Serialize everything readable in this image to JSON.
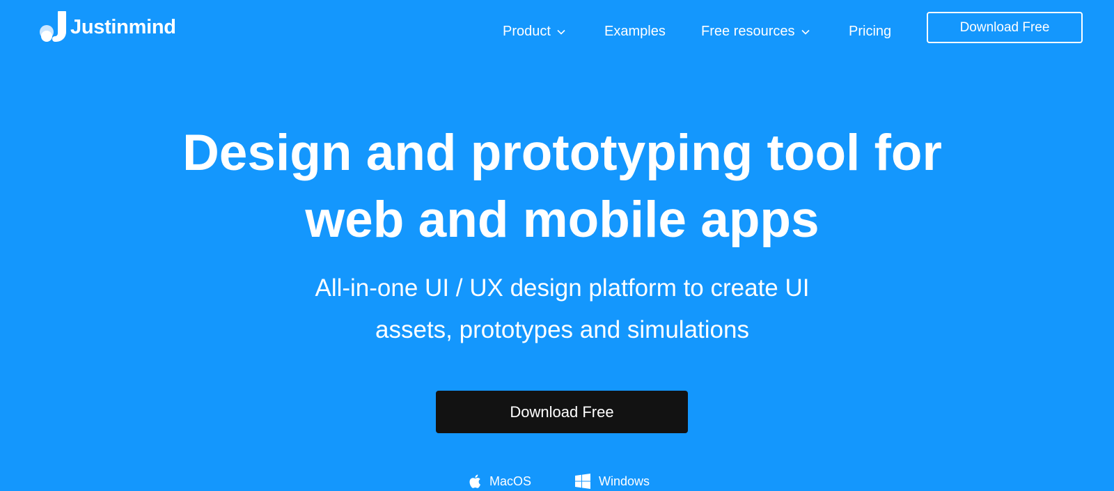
{
  "brand": {
    "name": "Justinmind"
  },
  "nav": {
    "items": [
      {
        "label": "Product",
        "has_dropdown": true
      },
      {
        "label": "Examples",
        "has_dropdown": false
      },
      {
        "label": "Free resources",
        "has_dropdown": true
      },
      {
        "label": "Pricing",
        "has_dropdown": false
      }
    ],
    "cta_label": "Download Free"
  },
  "hero": {
    "title_line1": "Design and prototyping tool for",
    "title_line2": "web and mobile apps",
    "subtitle_line1": "All-in-one UI / UX design platform to create UI",
    "subtitle_line2": "assets, prototypes and simulations",
    "cta_label": "Download Free"
  },
  "platforms": [
    {
      "label": "MacOS",
      "icon": "apple-icon"
    },
    {
      "label": "Windows",
      "icon": "windows-icon"
    }
  ],
  "colors": {
    "background": "#1497fd",
    "primary_button": "#121212",
    "text": "#ffffff"
  }
}
